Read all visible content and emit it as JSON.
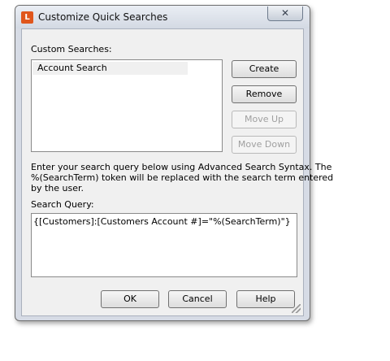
{
  "window": {
    "title": "Customize Quick Searches",
    "app_icon_letter": "L",
    "close_glyph": "✕"
  },
  "custom_searches": {
    "label": "Custom Searches:",
    "items": [
      {
        "label": "Account Search",
        "selected": false
      }
    ]
  },
  "side_buttons": {
    "create": "Create",
    "remove": "Remove",
    "move_up": "Move Up",
    "move_down": "Move Down"
  },
  "instructions": {
    "line1": "Enter your search query below using Advanced Search Syntax.  The",
    "line2": "%(SearchTerm) token will be replaced with the search term entered",
    "line3": "by the user."
  },
  "search_query": {
    "label": "Search Query:",
    "value": "{[Customers]:[Customers Account #]=\"%(SearchTerm)\"}"
  },
  "footer": {
    "ok": "OK",
    "cancel": "Cancel",
    "help": "Help"
  },
  "colors": {
    "accent": "#e0561c",
    "dialog_frame": "#d6dbe5",
    "client_bg": "#f0f0f0"
  }
}
